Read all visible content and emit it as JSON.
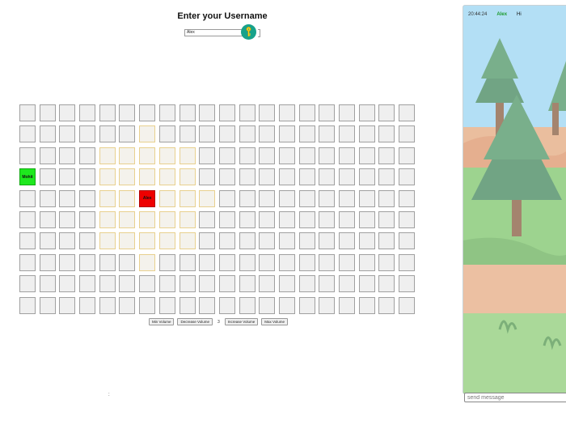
{
  "header": {
    "title": "Enter your Username"
  },
  "username": {
    "value": "Alex"
  },
  "grid": {
    "rows": 10,
    "cols": 20,
    "range_cells": [
      [
        1,
        6
      ],
      [
        2,
        4
      ],
      [
        2,
        5
      ],
      [
        2,
        6
      ],
      [
        2,
        7
      ],
      [
        2,
        8
      ],
      [
        3,
        4
      ],
      [
        3,
        5
      ],
      [
        3,
        6
      ],
      [
        3,
        7
      ],
      [
        3,
        8
      ],
      [
        4,
        4
      ],
      [
        4,
        5
      ],
      [
        4,
        7
      ],
      [
        4,
        8
      ],
      [
        4,
        9
      ],
      [
        5,
        4
      ],
      [
        5,
        5
      ],
      [
        5,
        6
      ],
      [
        5,
        7
      ],
      [
        5,
        8
      ],
      [
        6,
        4
      ],
      [
        6,
        5
      ],
      [
        6,
        6
      ],
      [
        6,
        7
      ],
      [
        6,
        8
      ],
      [
        7,
        6
      ]
    ],
    "users": [
      {
        "row": 4,
        "col": 6,
        "label": "Alex",
        "role": "self",
        "color": "#ee0000"
      },
      {
        "row": 3,
        "col": 0,
        "label": "Mohit",
        "role": "other",
        "color": "#1ee81e"
      }
    ]
  },
  "volume": {
    "min_label": "Min Volume",
    "decrease_label": "Decrease Volume",
    "value": "3",
    "increase_label": "Increase Volume",
    "max_label": "Max Volume"
  },
  "footer": {
    "separator": ":"
  },
  "chat": {
    "messages": [
      {
        "time": "20:44:24",
        "user": "Alex",
        "text": "Hi"
      }
    ],
    "input_placeholder": "send message"
  },
  "icons": {
    "submit": "key-icon"
  },
  "colors": {
    "accent": "#17a28a",
    "self": "#ee0000",
    "other": "#1ee81e",
    "chat_user": "#1a9a2a"
  }
}
